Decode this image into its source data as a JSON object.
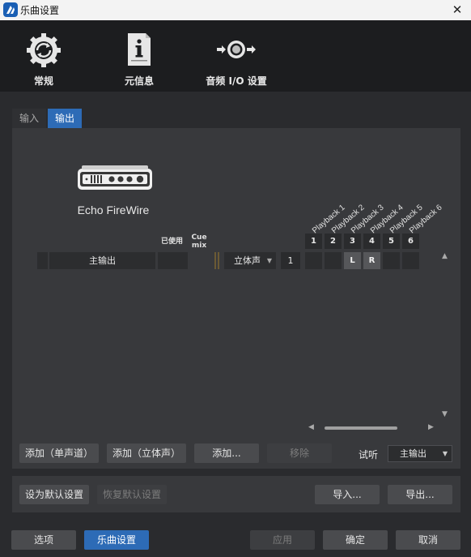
{
  "window": {
    "title": "乐曲设置",
    "close_glyph": "✕"
  },
  "categories": [
    {
      "label": "常规",
      "icon": "gear-refresh-icon"
    },
    {
      "label": "元信息",
      "icon": "info-document-icon"
    },
    {
      "label": "音频 I/O 设置",
      "icon": "audio-io-icon"
    }
  ],
  "tabs": {
    "input": "输入",
    "output": "输出",
    "active": "output"
  },
  "device": {
    "name": "Echo FireWire"
  },
  "columns": {
    "used": "已使用",
    "cue_mix": "Cue\nmix"
  },
  "playback_channels": [
    {
      "label": "Playback 1",
      "number": "1"
    },
    {
      "label": "Playback 2",
      "number": "2"
    },
    {
      "label": "Playback 3",
      "number": "3"
    },
    {
      "label": "Playback 4",
      "number": "4"
    },
    {
      "label": "Playback 5",
      "number": "5"
    },
    {
      "label": "Playback 6",
      "number": "6"
    }
  ],
  "output_row": {
    "name": "主输出",
    "format": "立体声",
    "channel_count": "1",
    "assignments": [
      "",
      "",
      "L",
      "R",
      "",
      ""
    ]
  },
  "actions": {
    "add_mono": "添加（单声道）",
    "add_stereo": "添加（立体声）",
    "add": "添加...",
    "remove": "移除",
    "preview_label": "试听",
    "preview_value": "主输出",
    "set_default": "设为默认设置",
    "restore_default": "恢复默认设置",
    "import": "导入...",
    "export": "导出..."
  },
  "footer": {
    "options": "选项",
    "song_setup": "乐曲设置",
    "apply": "应用",
    "ok": "确定",
    "cancel": "取消"
  },
  "colors": {
    "accent": "#2d6bb6",
    "background": "#2a2b2e",
    "panel": "#38393c"
  }
}
